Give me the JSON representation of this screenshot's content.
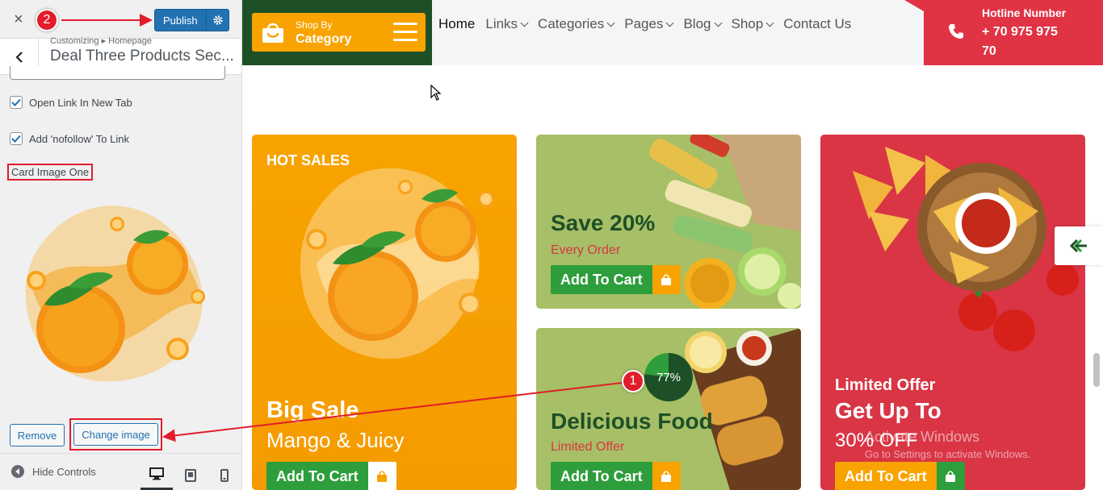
{
  "sidebar": {
    "close_icon": "×",
    "publish_label": "Publish",
    "section_crumb": "Customizing ▸ Homepage",
    "section_title": "Deal Three Products Sec...",
    "open_new_tab_label": "Open Link In New Tab",
    "nofollow_label": "Add 'nofollow' To Link",
    "card_image_label": "Card Image One",
    "remove_label": "Remove",
    "change_image_label": "Change image",
    "hide_controls_label": "Hide Controls"
  },
  "header": {
    "shop_by_small": "Shop By",
    "shop_by_big": "Category",
    "nav": [
      {
        "label": "Home",
        "active": true
      },
      {
        "label": "Links"
      },
      {
        "label": "Categories"
      },
      {
        "label": "Pages"
      },
      {
        "label": "Blog"
      },
      {
        "label": "Shop"
      },
      {
        "label": "Contact Us"
      }
    ],
    "hotline_title": "Hotline Number",
    "hotline_number": "+ 70 975 975 70"
  },
  "cards": {
    "hot": {
      "tag": "HOT SALES",
      "title": "Big Sale",
      "subtitle": "Mango & Juicy",
      "button": "Add To Cart"
    },
    "save": {
      "title": "Save 20%",
      "subtitle": "Every Order",
      "button": "Add To Cart"
    },
    "food": {
      "badge": "77%",
      "title": "Delicious Food",
      "subtitle": "Limited Offer",
      "button": "Add To Cart"
    },
    "limited": {
      "tag": "Limited Offer",
      "title": "Get Up To",
      "subtitle": "30% OFF",
      "button": "Add To Cart"
    }
  },
  "watermark": {
    "line1": "Activate Windows",
    "line2": "Go to Settings to activate Windows."
  },
  "annotations": {
    "one": "1",
    "two": "2"
  },
  "colors": {
    "green": "#1e5028",
    "orange": "#f8a300",
    "red": "#d93545",
    "wp_blue": "#2271b1"
  }
}
